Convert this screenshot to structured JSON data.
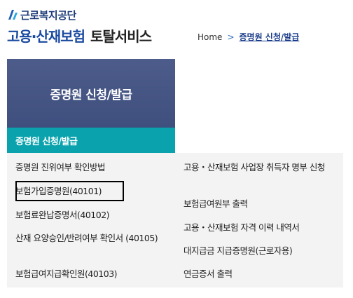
{
  "header": {
    "agency_name": "근로복지공단",
    "service_title_blue": "고용·산재보험",
    "service_title_dark": "토탈서비스"
  },
  "breadcrumb": {
    "home": "Home",
    "separator": ">",
    "current": "증명원 신청/발급"
  },
  "banner": {
    "title": "증명원 신청/발급"
  },
  "menu": {
    "active_label": "증명원 신청/발급"
  },
  "submenu": {
    "left": [
      "증명원 진위여부 확인방법",
      "보험가입증명원(40101)",
      "보험료완납증명서(40102)",
      "산재 요양승인/반려여부 확인서 (40105)",
      "보험급여지급확인원(40103)"
    ],
    "right": [
      "고용・산재보험 사업장 취득자 명부 신청",
      "보험급여원부 출력",
      "고용・산재보험 자격 이력 내역서",
      "대지급금 지급증명원(근로자용)",
      "연금증서 출력"
    ]
  },
  "colors": {
    "banner": "#4a5a88",
    "active_menu": "#0aa3ad",
    "brand_blue": "#1a4aa0",
    "submenu_bg": "#f3f3f3"
  },
  "icons": {
    "agency_logo": "kcomwel-logo-icon",
    "breadcrumb_separator": "chevron-right-icon"
  }
}
